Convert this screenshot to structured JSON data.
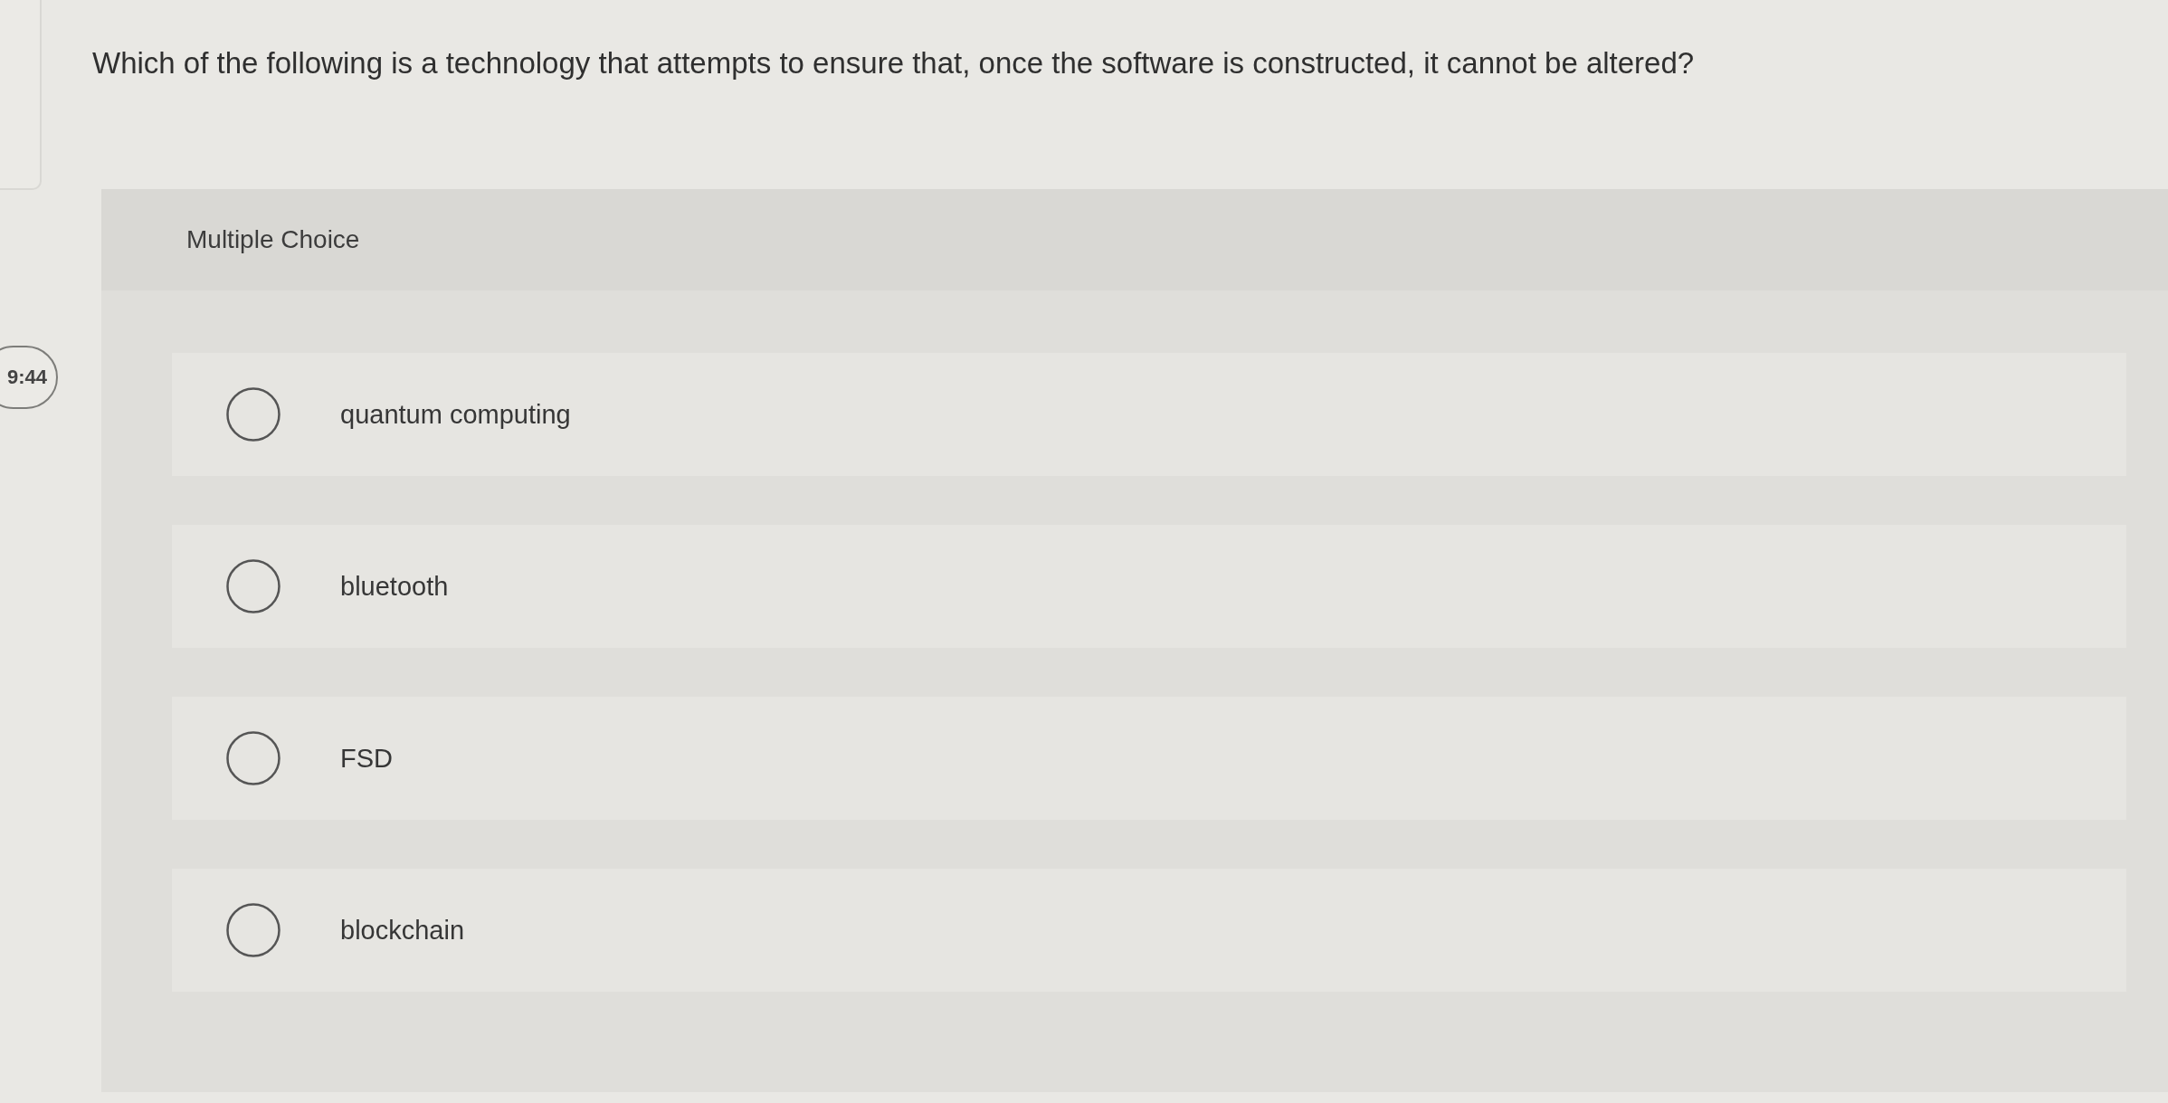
{
  "timer": {
    "text": "9:44"
  },
  "question": {
    "text": "Which of the following is a technology that attempts to ensure that, once the software is constructed, it cannot be altered?"
  },
  "answer_area": {
    "label": "Multiple Choice",
    "options": [
      {
        "label": "quantum computing",
        "selected": false
      },
      {
        "label": "bluetooth",
        "selected": false
      },
      {
        "label": "FSD",
        "selected": false
      },
      {
        "label": "blockchain",
        "selected": false
      }
    ]
  }
}
